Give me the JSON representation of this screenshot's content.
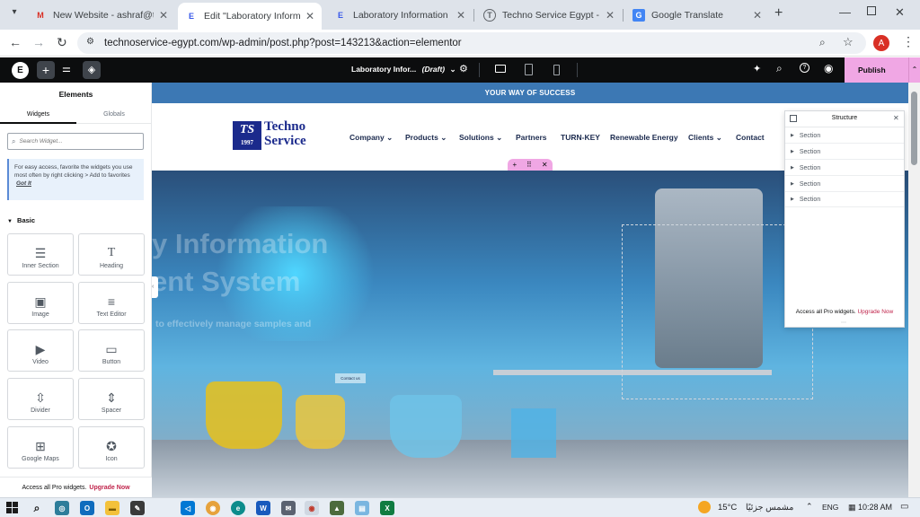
{
  "browser": {
    "tabs": [
      {
        "title": "New Website - ashraf@techno",
        "favicon": "M",
        "active": false
      },
      {
        "title": "Edit \"Laboratory Information",
        "favicon": "E",
        "active": true
      },
      {
        "title": "Laboratory Information Man",
        "favicon": "E",
        "active": false
      },
      {
        "title": "Techno Service Egypt - Auto",
        "favicon": "T",
        "active": false
      },
      {
        "title": "Google Translate",
        "favicon": "G",
        "active": false
      }
    ],
    "url": "technoservice-egypt.com/wp-admin/post.php?post=143213&action=elementor",
    "profile_initial": "A"
  },
  "editor": {
    "page_title": "Laboratory Infor...",
    "draft_label": "(Draft)",
    "publish_label": "Publish"
  },
  "panel": {
    "heading": "Elements",
    "tabs": [
      "Widgets",
      "Globals"
    ],
    "search_placeholder": "Search Widget...",
    "tip_text": "For easy access, favorite the widgets you use most often by right clicking > Add to favorites",
    "tip_link": "Got It",
    "category": "Basic",
    "widgets": [
      "Inner Section",
      "Heading",
      "Image",
      "Text Editor",
      "Video",
      "Button",
      "Divider",
      "Spacer",
      "Google Maps",
      "Icon"
    ],
    "pro_text": "Access all Pro widgets.",
    "pro_link": "Upgrade Now"
  },
  "site": {
    "banner": "YOUR WAY OF SUCCESS",
    "logo_top": "Techno",
    "logo_bottom": "Service",
    "logo_badge": "TS",
    "logo_year": "1997",
    "nav": [
      "Company",
      "Products",
      "Solutions",
      "Partners",
      "TURN-KEY",
      "Renewable Energy",
      "Clients",
      "Contact"
    ],
    "hero_line1": "y Information",
    "hero_line2": "ent System",
    "hero_sub": "to effectively manage samples and",
    "hero_button": "Contact us"
  },
  "structure": {
    "title": "Structure",
    "rows": [
      "Section",
      "Section",
      "Section",
      "Section",
      "Section"
    ],
    "pro_text": "Access all Pro widgets.",
    "pro_link": "Upgrade Now"
  },
  "taskbar": {
    "temperature": "15°C",
    "weather": "مشمس جزئيًا",
    "language": "ENG",
    "time": "10:28 AM"
  },
  "colors": {
    "accent_pink": "#f0a7e4",
    "brand_blue": "#3c78b4",
    "editor_dark": "#0c0d0e",
    "upgrade_red": "#c0244b"
  }
}
